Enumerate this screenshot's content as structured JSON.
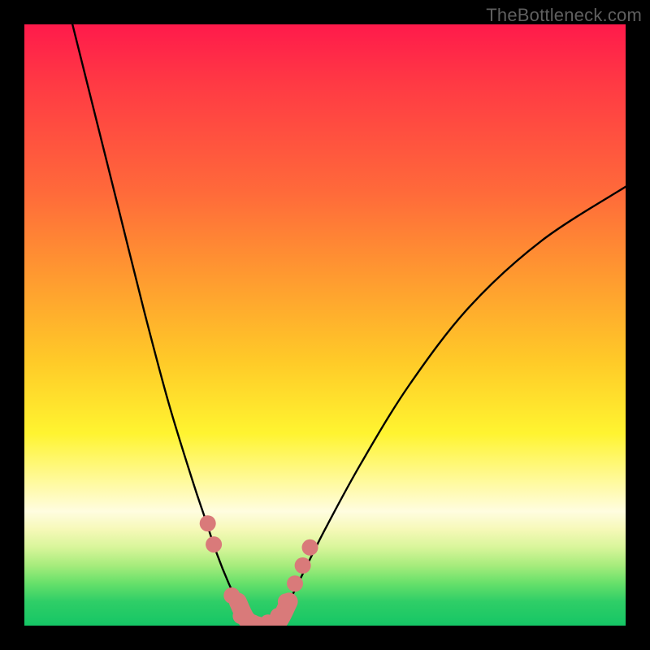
{
  "watermark": "TheBottleneck.com",
  "chart_data": {
    "type": "line",
    "title": "",
    "xlabel": "",
    "ylabel": "",
    "xlim": [
      0,
      100
    ],
    "ylim": [
      0,
      100
    ],
    "series": [
      {
        "name": "left-curve",
        "x": [
          8,
          12,
          16,
          20,
          24,
          28,
          30,
          32,
          34,
          35.5,
          37
        ],
        "values": [
          100,
          84,
          68,
          52,
          37,
          24,
          18,
          12,
          7,
          4,
          1
        ]
      },
      {
        "name": "right-curve",
        "x": [
          42,
          44,
          46,
          50,
          56,
          64,
          74,
          86,
          100
        ],
        "values": [
          1,
          4,
          8,
          16,
          27,
          40,
          53,
          64,
          73
        ]
      },
      {
        "name": "valley-floor",
        "x": [
          35.5,
          37,
          39,
          41,
          42.5,
          44
        ],
        "values": [
          4,
          1,
          0,
          0,
          1,
          4
        ]
      }
    ],
    "markers": {
      "name": "dots",
      "color": "#d97a7a",
      "points": [
        {
          "x": 30.5,
          "y": 17
        },
        {
          "x": 31.5,
          "y": 13.5
        },
        {
          "x": 34.5,
          "y": 5
        },
        {
          "x": 36,
          "y": 1.6
        },
        {
          "x": 38,
          "y": 0.5
        },
        {
          "x": 40.5,
          "y": 0.5
        },
        {
          "x": 42.2,
          "y": 1.6
        },
        {
          "x": 43.5,
          "y": 4
        },
        {
          "x": 45,
          "y": 7
        },
        {
          "x": 46.3,
          "y": 10
        },
        {
          "x": 47.5,
          "y": 13
        }
      ]
    },
    "colors": {
      "curve": "#000000",
      "marker": "#d97a7a",
      "gradient_top": "#ff1a4b",
      "gradient_bottom": "#15c665"
    }
  }
}
